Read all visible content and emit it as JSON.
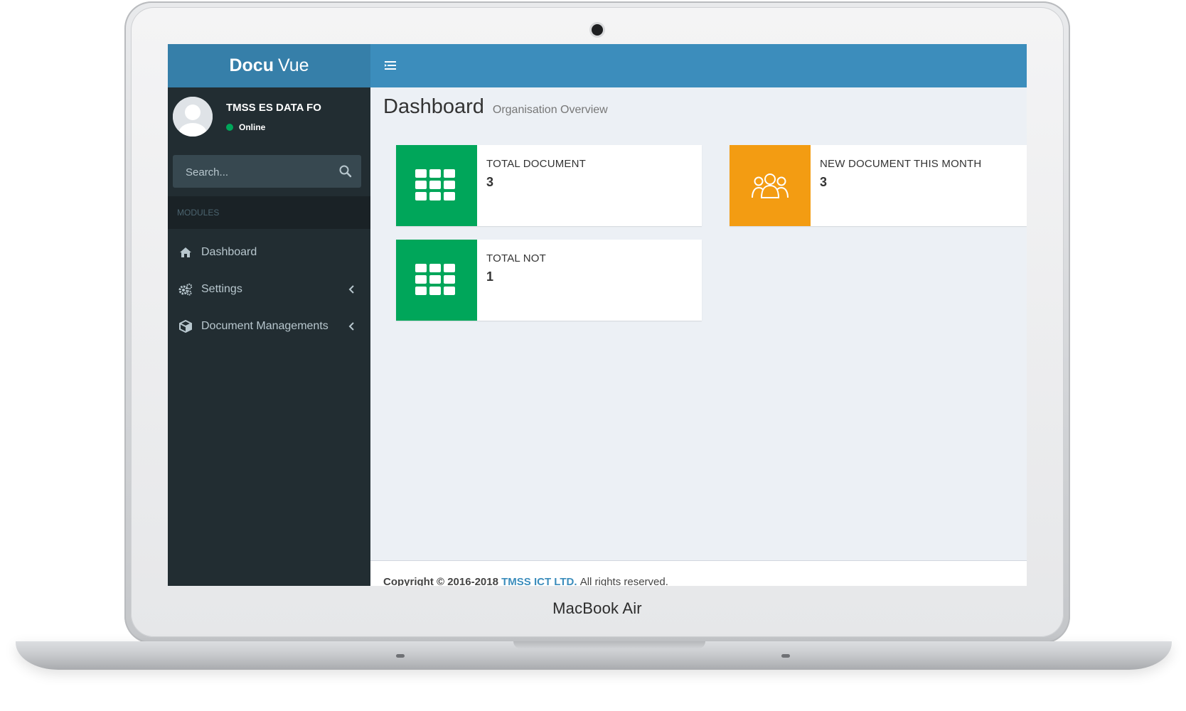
{
  "device": {
    "label": "MacBook Air"
  },
  "app": {
    "logo_bold": "Docu",
    "logo_light": "Vue"
  },
  "user": {
    "name": "TMSS ES DATA FO",
    "status": "Online"
  },
  "search": {
    "placeholder": "Search..."
  },
  "sidebar": {
    "section_header": "MODULES",
    "items": [
      {
        "label": "Dashboard",
        "icon": "home-icon"
      },
      {
        "label": "Settings",
        "icon": "gears-icon",
        "has_submenu": true
      },
      {
        "label": "Document Managements",
        "icon": "cube-icon",
        "has_submenu": true
      }
    ]
  },
  "page": {
    "title": "Dashboard",
    "subtitle": "Organisation Overview"
  },
  "info_boxes": [
    {
      "label": "TOTAL DOCUMENT",
      "value": "3",
      "color": "#00a65a",
      "icon": "grid-icon"
    },
    {
      "label": "NEW DOCUMENT THIS MONTH",
      "value": "3",
      "color": "#f39c12",
      "icon": "users-icon"
    },
    {
      "label": "TOTAL NOT",
      "value": "1",
      "color": "#00a65a",
      "icon": "grid-icon"
    }
  ],
  "footer": {
    "copyright": "Copyright © 2016-2018",
    "company": "TMSS ICT LTD.",
    "rights": "All rights reserved."
  },
  "colors": {
    "header": "#3c8dbc",
    "logo_bg": "#367fa9",
    "sidebar": "#222d32",
    "content_bg": "#ecf0f5"
  }
}
